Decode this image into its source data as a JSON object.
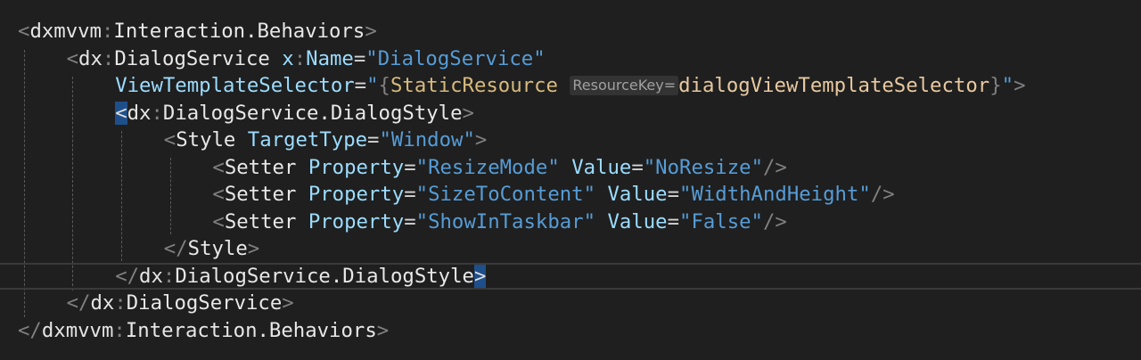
{
  "lines": [
    {
      "indent": 0,
      "tokens": [
        {
          "t": "<",
          "c": "t-punct"
        },
        {
          "t": "dxmvvm",
          "c": "t-ns"
        },
        {
          "t": ":",
          "c": "t-colon"
        },
        {
          "t": "Interaction.Behaviors",
          "c": "t-elem"
        },
        {
          "t": ">",
          "c": "t-punct"
        }
      ]
    },
    {
      "indent": 1,
      "tokens": [
        {
          "t": "<",
          "c": "t-punct"
        },
        {
          "t": "dx",
          "c": "t-ns"
        },
        {
          "t": ":",
          "c": "t-colon"
        },
        {
          "t": "DialogService",
          "c": "t-elem"
        },
        {
          "t": " ",
          "c": ""
        },
        {
          "t": "x",
          "c": "t-attr"
        },
        {
          "t": ":",
          "c": "t-colon"
        },
        {
          "t": "Name",
          "c": "t-attr"
        },
        {
          "t": "=",
          "c": "t-eq"
        },
        {
          "t": "\"DialogService\"",
          "c": "t-str"
        }
      ]
    },
    {
      "indent": 2,
      "tokens": [
        {
          "t": "ViewTemplateSelector",
          "c": "t-attr"
        },
        {
          "t": "=",
          "c": "t-eq"
        },
        {
          "t": "\"",
          "c": "t-str"
        },
        {
          "t": "{",
          "c": "t-punct"
        },
        {
          "t": "StaticResource",
          "c": "t-markup"
        },
        {
          "t": " ",
          "c": ""
        },
        {
          "t": "ResourceKey=",
          "c": "t-hint"
        },
        {
          "t": "dialogViewTemplateSelector",
          "c": "t-val"
        },
        {
          "t": "}",
          "c": "t-punct"
        },
        {
          "t": "\"",
          "c": "t-str"
        },
        {
          "t": ">",
          "c": "t-punct"
        }
      ]
    },
    {
      "indent": 2,
      "tokens": [
        {
          "t": "<",
          "c": "t-punct t-match"
        },
        {
          "t": "dx",
          "c": "t-ns"
        },
        {
          "t": ":",
          "c": "t-colon"
        },
        {
          "t": "DialogService.DialogStyle",
          "c": "t-elem"
        },
        {
          "t": ">",
          "c": "t-punct"
        }
      ]
    },
    {
      "indent": 3,
      "tokens": [
        {
          "t": "<",
          "c": "t-punct"
        },
        {
          "t": "Style",
          "c": "t-elem"
        },
        {
          "t": " ",
          "c": ""
        },
        {
          "t": "TargetType",
          "c": "t-attr"
        },
        {
          "t": "=",
          "c": "t-eq"
        },
        {
          "t": "\"Window\"",
          "c": "t-str"
        },
        {
          "t": ">",
          "c": "t-punct"
        }
      ]
    },
    {
      "indent": 4,
      "tokens": [
        {
          "t": "<",
          "c": "t-punct"
        },
        {
          "t": "Setter",
          "c": "t-elem"
        },
        {
          "t": " ",
          "c": ""
        },
        {
          "t": "Property",
          "c": "t-attr"
        },
        {
          "t": "=",
          "c": "t-eq"
        },
        {
          "t": "\"ResizeMode\"",
          "c": "t-str"
        },
        {
          "t": " ",
          "c": ""
        },
        {
          "t": "Value",
          "c": "t-attr"
        },
        {
          "t": "=",
          "c": "t-eq"
        },
        {
          "t": "\"NoResize\"",
          "c": "t-str"
        },
        {
          "t": "/>",
          "c": "t-punct"
        }
      ]
    },
    {
      "indent": 4,
      "tokens": [
        {
          "t": "<",
          "c": "t-punct"
        },
        {
          "t": "Setter",
          "c": "t-elem"
        },
        {
          "t": " ",
          "c": ""
        },
        {
          "t": "Property",
          "c": "t-attr"
        },
        {
          "t": "=",
          "c": "t-eq"
        },
        {
          "t": "\"SizeToContent\"",
          "c": "t-str"
        },
        {
          "t": " ",
          "c": ""
        },
        {
          "t": "Value",
          "c": "t-attr"
        },
        {
          "t": "=",
          "c": "t-eq"
        },
        {
          "t": "\"WidthAndHeight\"",
          "c": "t-str"
        },
        {
          "t": "/>",
          "c": "t-punct"
        }
      ]
    },
    {
      "indent": 4,
      "tokens": [
        {
          "t": "<",
          "c": "t-punct"
        },
        {
          "t": "Setter",
          "c": "t-elem"
        },
        {
          "t": " ",
          "c": ""
        },
        {
          "t": "Property",
          "c": "t-attr"
        },
        {
          "t": "=",
          "c": "t-eq"
        },
        {
          "t": "\"ShowInTaskbar\"",
          "c": "t-str"
        },
        {
          "t": " ",
          "c": ""
        },
        {
          "t": "Value",
          "c": "t-attr"
        },
        {
          "t": "=",
          "c": "t-eq"
        },
        {
          "t": "\"False\"",
          "c": "t-str"
        },
        {
          "t": "/>",
          "c": "t-punct"
        }
      ]
    },
    {
      "indent": 3,
      "tokens": [
        {
          "t": "</",
          "c": "t-punct"
        },
        {
          "t": "Style",
          "c": "t-elem"
        },
        {
          "t": ">",
          "c": "t-punct"
        }
      ]
    },
    {
      "indent": 2,
      "current": true,
      "tokens": [
        {
          "t": "</",
          "c": "t-punct"
        },
        {
          "t": "dx",
          "c": "t-ns"
        },
        {
          "t": ":",
          "c": "t-colon"
        },
        {
          "t": "DialogService.DialogStyle",
          "c": "t-elem"
        },
        {
          "t": ">",
          "c": "t-punct t-match"
        }
      ]
    },
    {
      "indent": 1,
      "tokens": [
        {
          "t": "</",
          "c": "t-punct"
        },
        {
          "t": "dx",
          "c": "t-ns"
        },
        {
          "t": ":",
          "c": "t-colon"
        },
        {
          "t": "DialogService",
          "c": "t-elem"
        },
        {
          "t": ">",
          "c": "t-punct"
        }
      ]
    },
    {
      "indent": 0,
      "tokens": [
        {
          "t": "</",
          "c": "t-punct"
        },
        {
          "t": "dxmvvm",
          "c": "t-ns"
        },
        {
          "t": ":",
          "c": "t-colon"
        },
        {
          "t": "Interaction.Behaviors",
          "c": "t-elem"
        },
        {
          "t": ">",
          "c": "t-punct"
        }
      ]
    }
  ]
}
